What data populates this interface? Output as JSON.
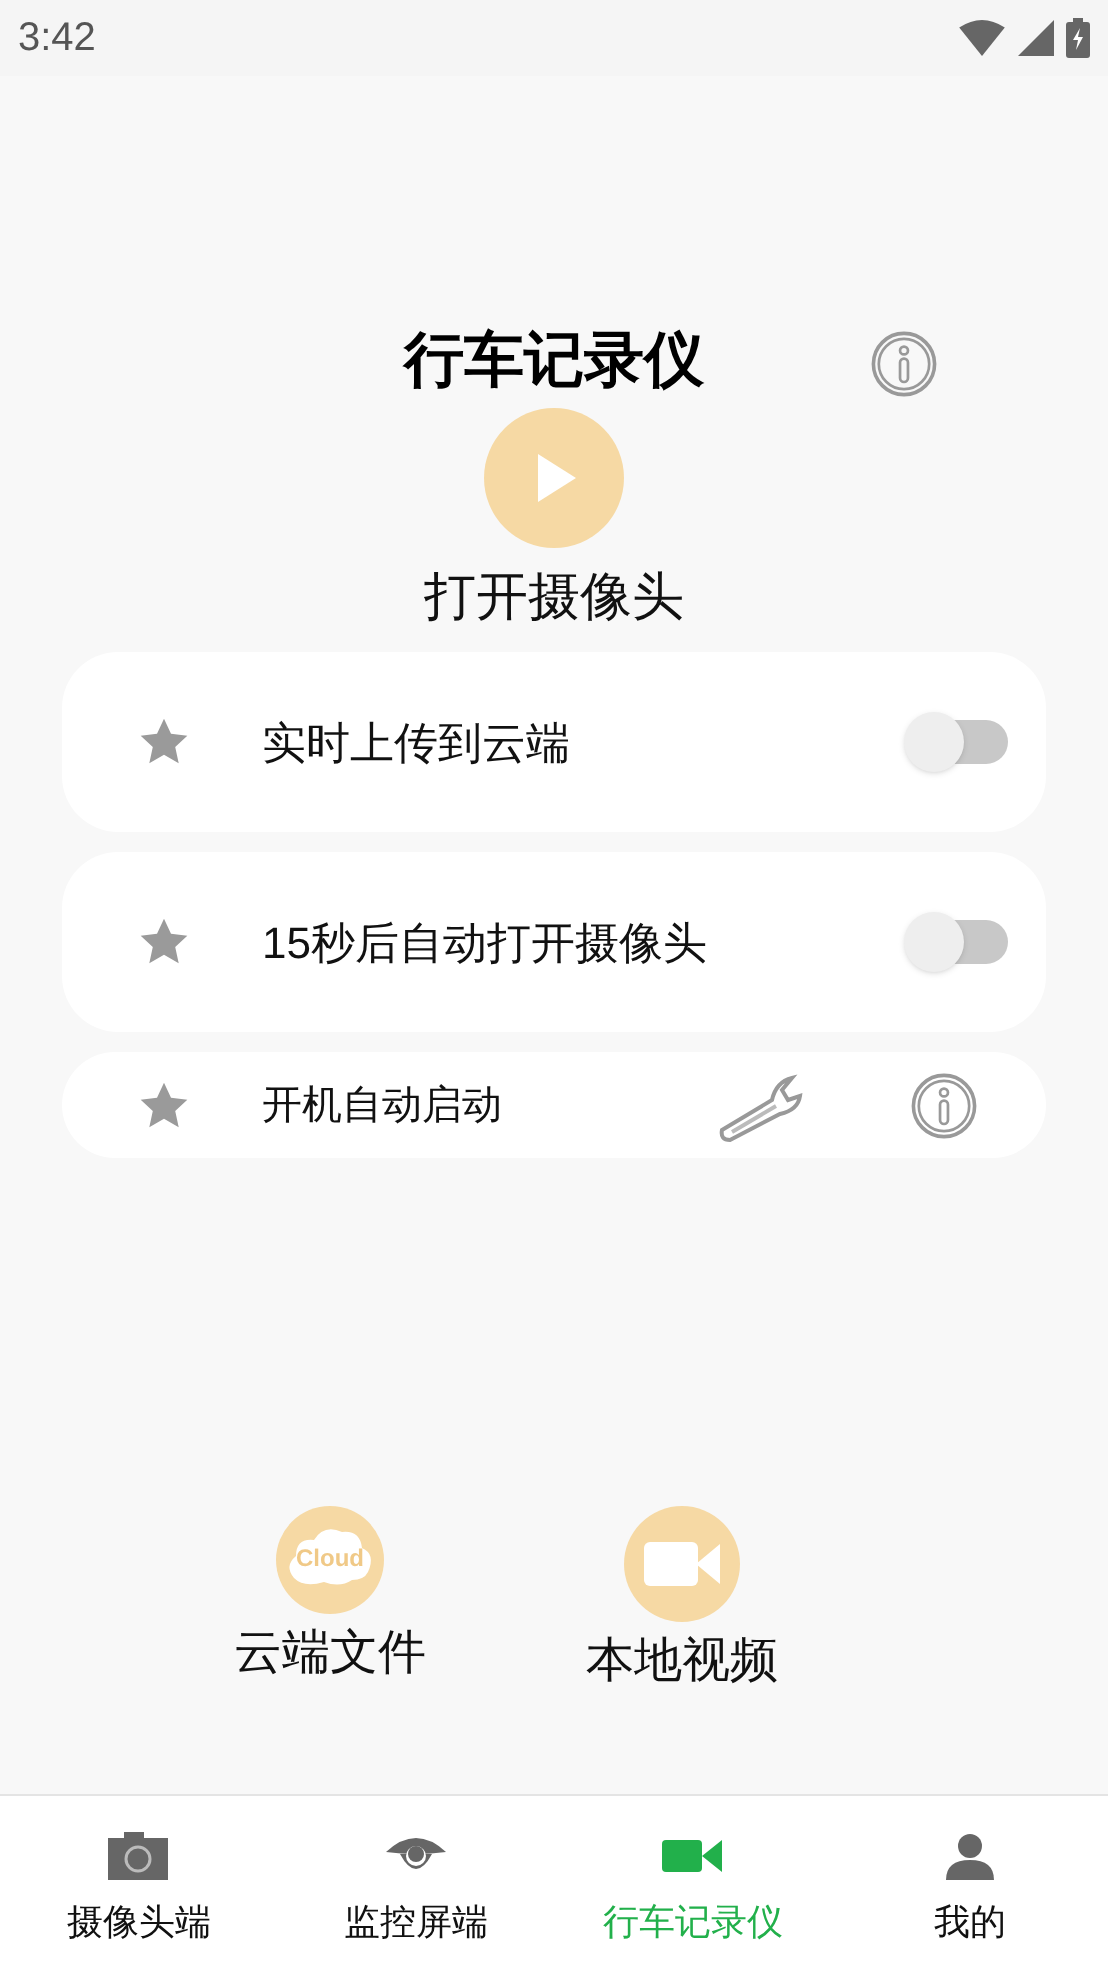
{
  "status_bar": {
    "time": "3:42"
  },
  "header": {
    "title": "行车记录仪",
    "action_label": "打开摄像头"
  },
  "settings": [
    {
      "kind": "toggle",
      "label": "实时上传到云端",
      "on": false
    },
    {
      "kind": "toggle",
      "label": "15秒后自动打开摄像头",
      "on": false
    },
    {
      "kind": "tools",
      "label": "开机自动启动"
    }
  ],
  "shortcuts": [
    {
      "kind": "cloud",
      "label": "云端文件",
      "icon_text": "Cloud"
    },
    {
      "kind": "video",
      "label": "本地视频"
    }
  ],
  "bottom_nav": [
    {
      "kind": "camera",
      "label": "摄像头端",
      "selected": false
    },
    {
      "kind": "eye",
      "label": "监控屏端",
      "selected": false
    },
    {
      "kind": "video",
      "label": "行车记录仪",
      "selected": true
    },
    {
      "kind": "person",
      "label": "我的",
      "selected": false
    }
  ]
}
